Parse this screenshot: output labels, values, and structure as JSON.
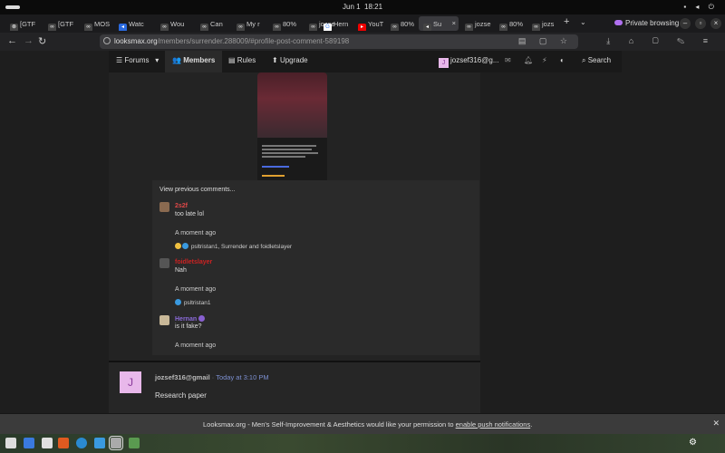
{
  "os": {
    "date": "Jun 1",
    "time": "18:21"
  },
  "tabs": [
    {
      "label": "[GTF",
      "icon": "globe-icon"
    },
    {
      "label": "[GTF",
      "icon": "looksmax-icon"
    },
    {
      "label": "MOS",
      "icon": "looksmax-icon"
    },
    {
      "label": "Watc",
      "icon": "speaker-icon"
    },
    {
      "label": "Wou",
      "icon": "looksmax-icon"
    },
    {
      "label": "Can",
      "icon": "looksmax-icon"
    },
    {
      "label": "My r",
      "icon": "looksmax-icon"
    },
    {
      "label": "80%",
      "icon": "looksmax-icon"
    },
    {
      "label": "jozse",
      "icon": "looksmax-icon"
    },
    {
      "label": "Hern",
      "icon": "google-icon"
    },
    {
      "label": "YouT",
      "icon": "youtube-icon"
    },
    {
      "label": "80%",
      "icon": "looksmax-icon"
    },
    {
      "label": "Su",
      "icon": "speaker-icon",
      "active": true
    },
    {
      "label": "jozse",
      "icon": "looksmax-icon"
    },
    {
      "label": "80%",
      "icon": "looksmax-icon"
    },
    {
      "label": "jozs",
      "icon": "looksmax-icon"
    }
  ],
  "private_label": "Private browsing",
  "url": {
    "host": "looksmax.org",
    "path": "/members/surrender.288009/#profile-post-comment-589198"
  },
  "site_nav": {
    "forums": "Forums",
    "members": "Members",
    "rules": "Rules",
    "upgrade": "Upgrade",
    "username": "jozsef316@g...",
    "user_initial": "J",
    "search": "Search"
  },
  "comments": {
    "view_previous": "View previous comments...",
    "items": [
      {
        "name": "2s2f",
        "name_color": "#e04848",
        "text": "too late lol",
        "time": "A moment ago",
        "reactions": "psltristan1, Surrender and foidletslayer"
      },
      {
        "name": "foidletslayer",
        "name_color": "#cc2222",
        "text": "Nah",
        "time": "A moment ago",
        "reactions": "psltristan1"
      },
      {
        "name": "Hernan",
        "name_color": "#8a6ad8",
        "text": "is it fake?",
        "time": "A moment ago",
        "reactions": ""
      }
    ]
  },
  "post2": {
    "initial": "J",
    "author": "jozsef316@gmail",
    "separator": " · ",
    "time": "Today at 3:10 PM",
    "body": "Research paper"
  },
  "notification": {
    "text": "Looksmax.org - Men's Self-Improvement & Aesthetics would like your permission to ",
    "link": "enable push notifications",
    "end": "."
  }
}
